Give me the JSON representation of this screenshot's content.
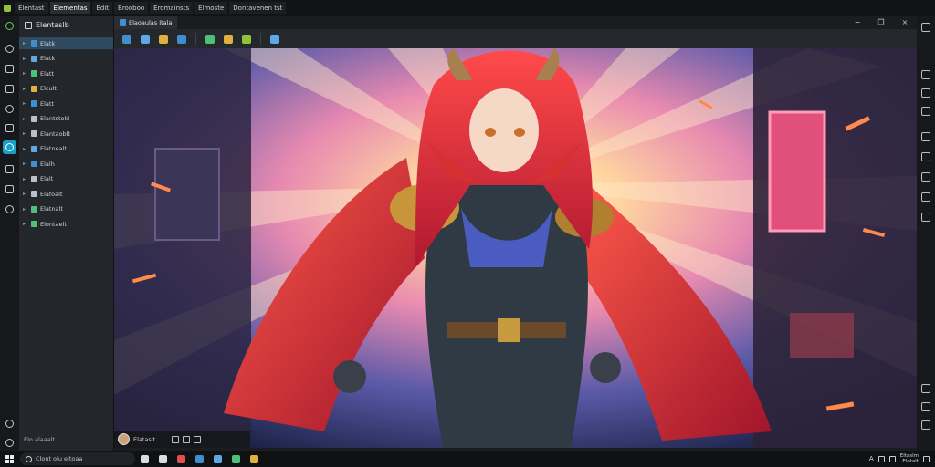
{
  "window": {
    "tabs": [
      {
        "label": "Elentast",
        "active": false
      },
      {
        "label": "Elementas",
        "active": true
      },
      {
        "label": "Edit",
        "active": false
      },
      {
        "label": "Brooboo",
        "active": false
      },
      {
        "label": "Eromainsts",
        "active": false
      },
      {
        "label": "Elmoste",
        "active": false
      },
      {
        "label": "Dontavenen tst",
        "active": false
      }
    ]
  },
  "explorer": {
    "title": "Elentaslb",
    "items": [
      {
        "label": "Elatk",
        "icon_color": "#3e8ed0",
        "selected": true
      },
      {
        "label": "Elatk",
        "icon_color": "#5fa8e6"
      },
      {
        "label": "Elatt",
        "icon_color": "#4fc07a"
      },
      {
        "label": "Elcult",
        "icon_color": "#e0b040"
      },
      {
        "label": "Elatt",
        "icon_color": "#3e8ed0"
      },
      {
        "label": "Elantstokl",
        "icon_color": "#b9c0c6"
      },
      {
        "label": "Elantaoblt",
        "icon_color": "#b9c0c6"
      },
      {
        "label": "Elatnealt",
        "icon_color": "#5fa8e6"
      },
      {
        "label": "Elalh",
        "icon_color": "#3e8ed0"
      },
      {
        "label": "Elalt",
        "icon_color": "#b9c0c6"
      },
      {
        "label": "Elafoalt",
        "icon_color": "#b9c0c6"
      },
      {
        "label": "Elatnalt",
        "icon_color": "#4fc07a"
      },
      {
        "label": "Elontaelt",
        "icon_color": "#4fc07a"
      }
    ],
    "footer": "Elo alaaalt"
  },
  "document": {
    "tab_label": "Elaoaulas Itala",
    "win_controls": [
      "−",
      "❐",
      "×"
    ],
    "toolbar_icons": [
      {
        "name": "image-icon",
        "color": "#3e8ed0"
      },
      {
        "name": "brush-icon",
        "color": "#5fa8e6"
      },
      {
        "name": "loop-icon",
        "color": "#e0b040"
      },
      {
        "name": "pen-icon",
        "color": "#3e8ed0"
      },
      {
        "name": "shapes-icon",
        "color": "#4fc07a"
      },
      {
        "name": "star-icon",
        "color": "#e0b040"
      },
      {
        "name": "refresh-icon",
        "color": "#8fc33a"
      },
      {
        "name": "grid-icon",
        "color": "#5fa8e6"
      }
    ]
  },
  "status": {
    "text": "Elataslt"
  },
  "taskbar": {
    "search_placeholder": "Clont oiu eltoaa",
    "apps": [
      "#d8dde2",
      "#d8dde2",
      "#e05050",
      "#3e8ed0",
      "#5fa8e6",
      "#4fc07a",
      "#e0b040"
    ],
    "tray_letter": "A",
    "tray_lines": [
      "Eltaslm",
      "Elotalt"
    ]
  }
}
